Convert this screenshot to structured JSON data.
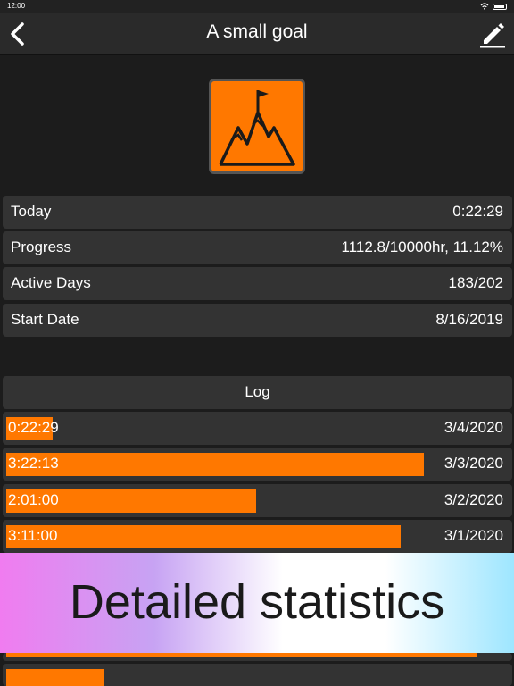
{
  "status_bar": {
    "time": "12:00"
  },
  "nav": {
    "title": "A small goal",
    "back_icon": "chevron-left-icon",
    "edit_icon": "pencil-icon"
  },
  "goal": {
    "icon": "mountain-flag-icon",
    "icon_color": "#ff7800"
  },
  "info": [
    {
      "label": "Today",
      "value": "0:22:29"
    },
    {
      "label": "Progress",
      "value": "1112.8/10000hr,  11.12%"
    },
    {
      "label": "Active Days",
      "value": "183/202"
    },
    {
      "label": "Start Date",
      "value": "8/16/2019"
    }
  ],
  "log": {
    "title": "Log",
    "bar_color": "#ff7800",
    "entries": [
      {
        "duration": "0:22:29",
        "date": "3/4/2020",
        "fill": 0.092
      },
      {
        "duration": "3:22:13",
        "date": "3/3/2020",
        "fill": 0.832
      },
      {
        "duration": "2:01:00",
        "date": "3/2/2020",
        "fill": 0.497
      },
      {
        "duration": "3:11:00",
        "date": "3/1/2020",
        "fill": 0.785
      }
    ]
  },
  "promo": {
    "text": "Detailed statistics"
  }
}
